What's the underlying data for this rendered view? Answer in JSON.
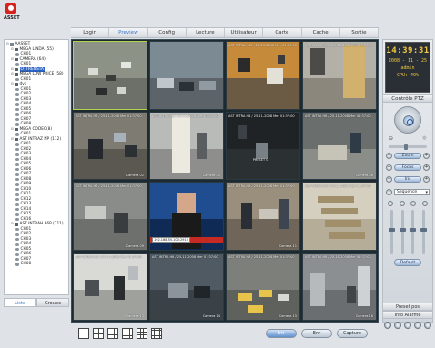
{
  "brand": {
    "logo_text": "ASSET"
  },
  "menu": [
    "Login",
    "Preview",
    "Config",
    "Lecture",
    "Utilisateur",
    "Carte",
    "Cache",
    "Sortie"
  ],
  "menu_active": 1,
  "tree": [
    {
      "level": 0,
      "type": "root",
      "label": "AASSET",
      "sign": "-"
    },
    {
      "level": 1,
      "type": "dvr",
      "label": "MEGA LINDA (55)",
      "sign": "-"
    },
    {
      "level": 2,
      "type": "cam",
      "label": "CH01"
    },
    {
      "level": 1,
      "type": "dvr",
      "label": "CAMERA (64)",
      "sign": "-"
    },
    {
      "level": 2,
      "type": "cam",
      "label": "CH01"
    },
    {
      "level": 1,
      "type": "dvr",
      "label": "OTTRENSTA",
      "sign": "-",
      "selected": true
    },
    {
      "level": 1,
      "type": "dvr",
      "label": "MEGA LOW PRICE (58)",
      "sign": "-"
    },
    {
      "level": 2,
      "type": "cam",
      "label": "CH01"
    },
    {
      "level": 1,
      "type": "dvr",
      "label": "dvs",
      "sign": "-"
    },
    {
      "level": 2,
      "type": "cam",
      "label": "CH01"
    },
    {
      "level": 2,
      "type": "cam",
      "label": "CH02"
    },
    {
      "level": 2,
      "type": "cam",
      "label": "CH03"
    },
    {
      "level": 2,
      "type": "cam",
      "label": "CH04"
    },
    {
      "level": 2,
      "type": "cam",
      "label": "CH05"
    },
    {
      "level": 2,
      "type": "cam",
      "label": "CH06"
    },
    {
      "level": 2,
      "type": "cam",
      "label": "CH07"
    },
    {
      "level": 2,
      "type": "cam",
      "label": "CH08"
    },
    {
      "level": 1,
      "type": "dvr",
      "label": "MEGA CODEC(8)",
      "sign": "-"
    },
    {
      "level": 2,
      "type": "cam",
      "label": "CH01"
    },
    {
      "level": 1,
      "type": "dvr",
      "label": "AST INTRAZ NP (112)",
      "sign": "-"
    },
    {
      "level": 2,
      "type": "cam",
      "label": "CH01"
    },
    {
      "level": 2,
      "type": "cam",
      "label": "CH02"
    },
    {
      "level": 2,
      "type": "cam",
      "label": "CH03"
    },
    {
      "level": 2,
      "type": "cam",
      "label": "CH04"
    },
    {
      "level": 2,
      "type": "cam",
      "label": "CH05"
    },
    {
      "level": 2,
      "type": "cam",
      "label": "CH06"
    },
    {
      "level": 2,
      "type": "cam",
      "label": "CH07"
    },
    {
      "level": 2,
      "type": "cam",
      "label": "CH08"
    },
    {
      "level": 2,
      "type": "cam",
      "label": "CH09"
    },
    {
      "level": 2,
      "type": "cam",
      "label": "CH10"
    },
    {
      "level": 2,
      "type": "cam",
      "label": "CH11"
    },
    {
      "level": 2,
      "type": "cam",
      "label": "CH12"
    },
    {
      "level": 2,
      "type": "cam",
      "label": "CH13"
    },
    {
      "level": 2,
      "type": "cam",
      "label": "CH14"
    },
    {
      "level": 2,
      "type": "cam",
      "label": "CH15"
    },
    {
      "level": 2,
      "type": "cam",
      "label": "CH16"
    },
    {
      "level": 1,
      "type": "dvr",
      "label": "AST INTRAH 86P (111)",
      "sign": "-"
    },
    {
      "level": 2,
      "type": "cam",
      "label": "CH01"
    },
    {
      "level": 2,
      "type": "cam",
      "label": "CH02"
    },
    {
      "level": 2,
      "type": "cam",
      "label": "CH03"
    },
    {
      "level": 2,
      "type": "cam",
      "label": "CH04"
    },
    {
      "level": 2,
      "type": "cam",
      "label": "CH05"
    },
    {
      "level": 2,
      "type": "cam",
      "label": "CH06"
    },
    {
      "level": 2,
      "type": "cam",
      "label": "CH07"
    },
    {
      "level": 2,
      "type": "cam",
      "label": "CH08"
    }
  ],
  "left_tabs": [
    "Liste",
    "Groupe"
  ],
  "left_tab_active": 0,
  "tiles": [
    {
      "osd": "",
      "cam": "",
      "scene": "parking-top",
      "selected": true
    },
    {
      "osd": "",
      "cam": "",
      "scene": "parking-side"
    },
    {
      "osd": "AST INTRA H62 / 25-11-2008 Mer 01:37:00",
      "cam": "",
      "scene": "office-orange"
    },
    {
      "osd": "AST INTRA H62 / 25-11-2008 Mer 01:37:00",
      "cam": "",
      "scene": "door"
    },
    {
      "osd": "AST INTRA H8 / 25-11-2008 Mer 01:37:00",
      "cam": "Camera 02",
      "scene": "office-desk"
    },
    {
      "osd": "AST INTRA H8 / 25-11-2008 Mer 01:37:00",
      "cam": "Camera 05",
      "scene": "corridor"
    },
    {
      "osd": "AST INTRA H8 / 25-11-2008 Mer 01:37:00",
      "cam": "",
      "scene": "dark-room",
      "overlay": "PRESET 0"
    },
    {
      "osd": "AST INTRA H8 / 25-11-2008 Mer 01:37:00",
      "cam": "Camera 06",
      "scene": "lobby"
    },
    {
      "osd": "AST INTRA H8 / 25-11-2008 Mer 01:37:00",
      "cam": "Camera 09",
      "scene": "workshop"
    },
    {
      "osd": "",
      "cam": "",
      "scene": "news",
      "ip": "192.168.55.100:2910"
    },
    {
      "osd": "AST INTRA H8 / 25-11-2008 Mer 01:37:00",
      "cam": "Camera 11",
      "scene": "office-people"
    },
    {
      "osd": "AST INTRA H8 / 25-11-2008 Mer 01:37:00",
      "cam": "",
      "scene": "stairs"
    },
    {
      "osd": "AST INTRA H8 / 25-11-2008 Mer 01:37:00",
      "cam": "Camera 13",
      "scene": "office-bright"
    },
    {
      "osd": "AST INTRA H8 / 25-11-2008 Mer 01:37:00",
      "cam": "Camera 14",
      "scene": "garage"
    },
    {
      "osd": "AST INTRA H8 / 25-11-2008 Mer 01:37:00",
      "cam": "Camera 15",
      "scene": "parking-yellow"
    },
    {
      "osd": "AST INTRA H8 / 25-11-2008 Mer 01:37:00",
      "cam": "Camera 16",
      "scene": "street"
    }
  ],
  "status": {
    "time": "14:39:31",
    "date": "2008 - 11 - 25",
    "user": "admin",
    "cpu": "CPU: 49%"
  },
  "ptz": {
    "title": "Contrôle PTZ",
    "zoom": "Zoom",
    "focus": "Focus",
    "iris": "Iris",
    "sequence": "Sequence",
    "default": "Default",
    "preset": "Preset pos",
    "alarm": "Info Alarme"
  },
  "bottom_buttons": [
    "Int",
    "Enr",
    "Capture"
  ],
  "bottom_button_active": 0,
  "colors": {
    "accent": "#3a78c8",
    "clock_text": "#f2c840",
    "selected_tile": "#b5d34a"
  }
}
